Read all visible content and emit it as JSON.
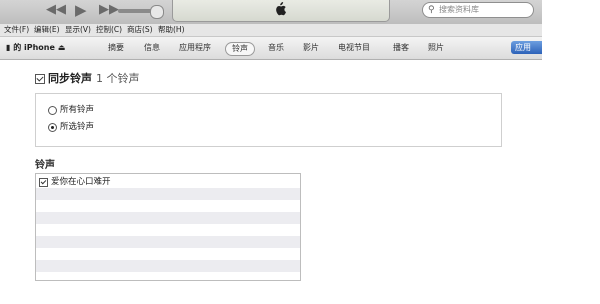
{
  "toolbar": {
    "prev_icon": "rewind-icon",
    "play_icon": "play-icon",
    "next_icon": "fast-forward-icon",
    "logo": "apple-logo",
    "search_placeholder": "搜索资料库"
  },
  "menu": {
    "items": [
      "文件(F)",
      "编辑(E)",
      "显示(V)",
      "控制(C)",
      "商店(S)",
      "帮助(H)"
    ]
  },
  "device": {
    "name": "的 iPhone",
    "eject_icon": "eject-icon",
    "tabs": [
      "摘要",
      "信息",
      "应用程序",
      "铃声",
      "音乐",
      "影片",
      "电视节目",
      "播客",
      "照片"
    ],
    "active_tab": "铃声",
    "apply_label": "应用"
  },
  "sync": {
    "title": "同步铃声",
    "count": "1 个铃声",
    "checked": true,
    "options": [
      {
        "label": "所有铃声",
        "selected": false
      },
      {
        "label": "所选铃声",
        "selected": true
      }
    ]
  },
  "ringtones": {
    "section_title": "铃声",
    "items": [
      {
        "label": "爱你在心口难开",
        "checked": true
      }
    ]
  },
  "colors": {
    "accent": "#2d62b8",
    "alt_row": "#ececf0"
  }
}
